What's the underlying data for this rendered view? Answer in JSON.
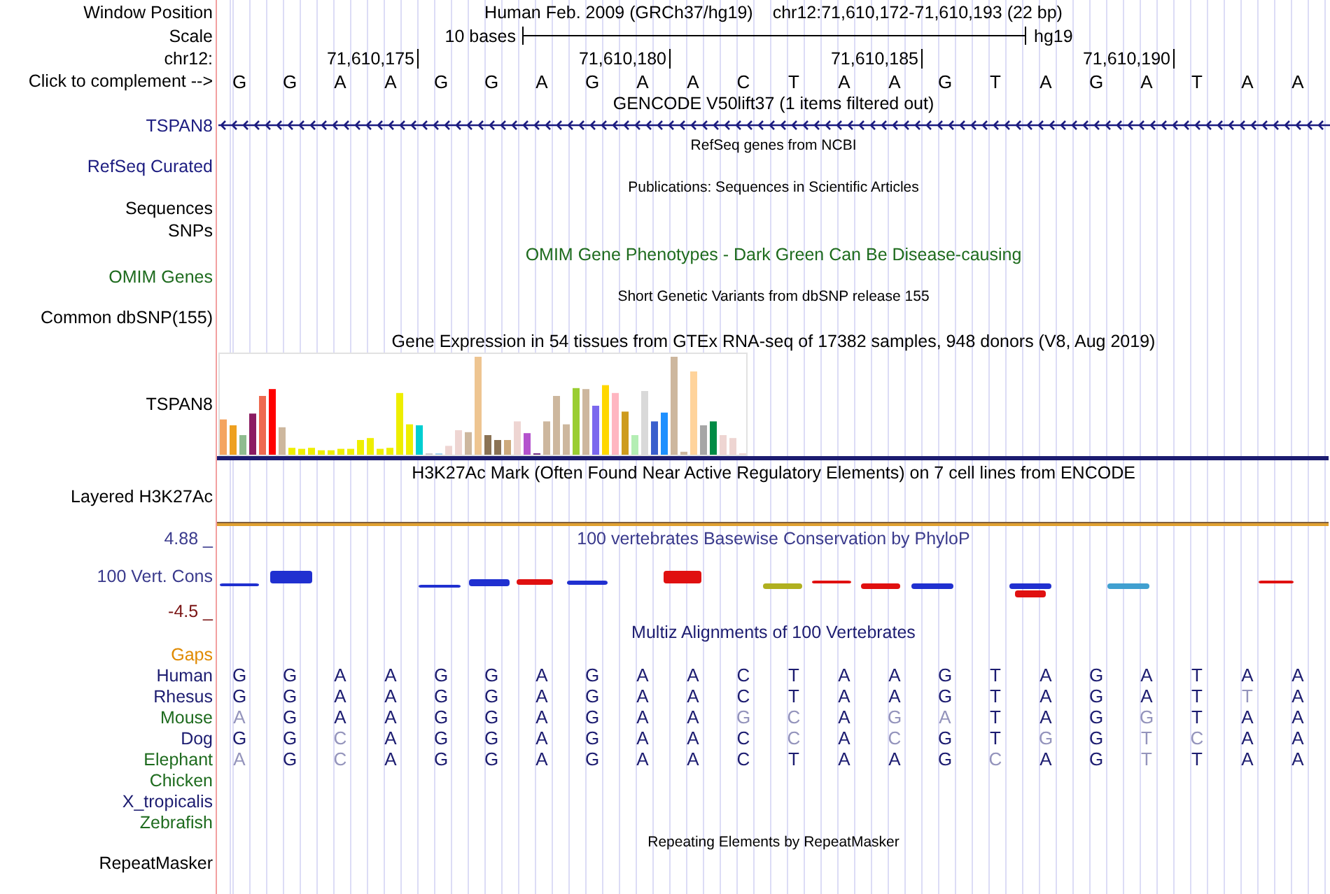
{
  "header": {
    "labels": [
      "Window Position",
      "Scale",
      "chr12:",
      "Click to complement -->"
    ],
    "assembly": "Human Feb. 2009 (GRCh37/hg19)",
    "range": "chr12:71,610,172-71,610,193 (22 bp)",
    "scale": "10 bases",
    "scale_db": "hg19",
    "ruler": [
      "71,610,175",
      "71,610,180",
      "71,610,185",
      "71,610,190"
    ],
    "sequence": [
      "G",
      "G",
      "A",
      "A",
      "G",
      "G",
      "A",
      "G",
      "A",
      "A",
      "C",
      "T",
      "A",
      "A",
      "G",
      "T",
      "A",
      "G",
      "A",
      "T",
      "A",
      "A"
    ]
  },
  "tracks": [
    {
      "kind": "gene",
      "title": {
        "text": "GENCODE V50lift37 (1 items filtered out)",
        "color": "#000000"
      },
      "labels": [
        {
          "text": "TSPAN8",
          "color": "#1c1c80"
        }
      ]
    },
    {
      "kind": "compact",
      "title": {
        "text": "RefSeq genes from NCBI",
        "color": "#000000"
      },
      "labels": [
        {
          "text": "RefSeq Curated",
          "color": "#1c1c80"
        }
      ]
    },
    {
      "kind": "compact",
      "title": {
        "text": "Publications: Sequences in Scientific Articles",
        "color": "#000000"
      },
      "labels": [
        {
          "text": "Sequences",
          "color": "#000000"
        },
        {
          "text": "SNPs",
          "color": "#000000"
        }
      ]
    },
    {
      "kind": "full",
      "title": {
        "text": "OMIM Gene Phenotypes - Dark Green Can Be Disease-causing",
        "color": "#1e6b1e"
      },
      "labels": [
        {
          "text": "OMIM Genes",
          "color": "#1e6b1e"
        }
      ]
    },
    {
      "kind": "compact",
      "title": {
        "text": "Short Genetic Variants from dbSNP release 155",
        "color": "#000000"
      },
      "labels": [
        {
          "text": "Common dbSNP(155)",
          "color": "#000000"
        }
      ]
    },
    {
      "kind": "bars",
      "title": {
        "text": "Gene Expression in 54 tissues from GTEx RNA-seq of 17382 samples, 948 donors (V8, Aug 2019)",
        "color": "#000000"
      },
      "labels": [
        {
          "text": "TSPAN8",
          "color": "#000000"
        }
      ]
    },
    {
      "kind": "signal",
      "title": {
        "text": "H3K27Ac Mark (Often Found Near Active Regulatory Elements) on 7 cell lines from ENCODE",
        "color": "#000000"
      },
      "labels": [
        {
          "text": "Layered H3K27Ac",
          "color": "#000000"
        }
      ]
    },
    {
      "kind": "conservation",
      "title": {
        "text": "100 vertebrates Basewise Conservation by PhyloP",
        "color": "#3a3a8c"
      },
      "labels": [
        {
          "text": "4.88 _",
          "color": "#3a3a8c"
        },
        {
          "text": "100 Vert. Cons",
          "color": "#3a3a8c"
        },
        {
          "text": "-4.5 _",
          "color": "#7a1414"
        }
      ]
    },
    {
      "kind": "alignment",
      "title": {
        "text": "Multiz Alignments of 100 Vertebrates",
        "color": "#1c1c70"
      },
      "labels": [
        {
          "text": "Gaps",
          "color": "#e08a00"
        }
      ],
      "species": [
        {
          "name": "Human",
          "color": "#1c1c70",
          "bases": [
            {
              "base": "G",
              "match": true
            },
            {
              "base": "G",
              "match": true
            },
            {
              "base": "A",
              "match": true
            },
            {
              "base": "A",
              "match": true
            },
            {
              "base": "G",
              "match": true
            },
            {
              "base": "G",
              "match": true
            },
            {
              "base": "A",
              "match": true
            },
            {
              "base": "G",
              "match": true
            },
            {
              "base": "A",
              "match": true
            },
            {
              "base": "A",
              "match": true
            },
            {
              "base": "C",
              "match": true
            },
            {
              "base": "T",
              "match": true
            },
            {
              "base": "A",
              "match": true
            },
            {
              "base": "A",
              "match": true
            },
            {
              "base": "G",
              "match": true
            },
            {
              "base": "T",
              "match": true
            },
            {
              "base": "A",
              "match": true
            },
            {
              "base": "G",
              "match": true
            },
            {
              "base": "A",
              "match": true
            },
            {
              "base": "T",
              "match": true
            },
            {
              "base": "A",
              "match": true
            },
            {
              "base": "A",
              "match": true
            }
          ]
        },
        {
          "name": "Rhesus",
          "color": "#1c1c70",
          "bases": [
            {
              "base": "G",
              "match": true
            },
            {
              "base": "G",
              "match": true
            },
            {
              "base": "A",
              "match": true
            },
            {
              "base": "A",
              "match": true
            },
            {
              "base": "G",
              "match": true
            },
            {
              "base": "G",
              "match": true
            },
            {
              "base": "A",
              "match": true
            },
            {
              "base": "G",
              "match": true
            },
            {
              "base": "A",
              "match": true
            },
            {
              "base": "A",
              "match": true
            },
            {
              "base": "C",
              "match": true
            },
            {
              "base": "T",
              "match": true
            },
            {
              "base": "A",
              "match": true
            },
            {
              "base": "A",
              "match": true
            },
            {
              "base": "G",
              "match": true
            },
            {
              "base": "T",
              "match": true
            },
            {
              "base": "A",
              "match": true
            },
            {
              "base": "G",
              "match": true
            },
            {
              "base": "A",
              "match": true
            },
            {
              "base": "T",
              "match": true
            },
            {
              "base": "T",
              "match": false
            },
            {
              "base": "A",
              "match": true
            }
          ]
        },
        {
          "name": "Mouse",
          "color": "#1e6b1e",
          "bases": [
            {
              "base": "A",
              "match": false
            },
            {
              "base": "G",
              "match": true
            },
            {
              "base": "A",
              "match": true
            },
            {
              "base": "A",
              "match": true
            },
            {
              "base": "G",
              "match": true
            },
            {
              "base": "G",
              "match": true
            },
            {
              "base": "A",
              "match": true
            },
            {
              "base": "G",
              "match": true
            },
            {
              "base": "A",
              "match": true
            },
            {
              "base": "A",
              "match": true
            },
            {
              "base": "G",
              "match": false
            },
            {
              "base": "C",
              "match": false
            },
            {
              "base": "A",
              "match": true
            },
            {
              "base": "G",
              "match": false
            },
            {
              "base": "A",
              "match": false
            },
            {
              "base": "T",
              "match": true
            },
            {
              "base": "A",
              "match": true
            },
            {
              "base": "G",
              "match": true
            },
            {
              "base": "G",
              "match": false
            },
            {
              "base": "T",
              "match": true
            },
            {
              "base": "A",
              "match": true
            },
            {
              "base": "A",
              "match": true
            }
          ]
        },
        {
          "name": "Dog",
          "color": "#1c1c70",
          "bases": [
            {
              "base": "G",
              "match": true
            },
            {
              "base": "G",
              "match": true
            },
            {
              "base": "C",
              "match": false
            },
            {
              "base": "A",
              "match": true
            },
            {
              "base": "G",
              "match": true
            },
            {
              "base": "G",
              "match": true
            },
            {
              "base": "A",
              "match": true
            },
            {
              "base": "G",
              "match": true
            },
            {
              "base": "A",
              "match": true
            },
            {
              "base": "A",
              "match": true
            },
            {
              "base": "C",
              "match": true
            },
            {
              "base": "C",
              "match": false
            },
            {
              "base": "A",
              "match": true
            },
            {
              "base": "C",
              "match": false
            },
            {
              "base": "G",
              "match": true
            },
            {
              "base": "T",
              "match": true
            },
            {
              "base": "G",
              "match": false
            },
            {
              "base": "G",
              "match": true
            },
            {
              "base": "T",
              "match": false
            },
            {
              "base": "C",
              "match": false
            },
            {
              "base": "A",
              "match": true
            },
            {
              "base": "A",
              "match": true
            }
          ]
        },
        {
          "name": "Elephant",
          "color": "#1e6b1e",
          "bases": [
            {
              "base": "A",
              "match": false
            },
            {
              "base": "G",
              "match": true
            },
            {
              "base": "C",
              "match": false
            },
            {
              "base": "A",
              "match": true
            },
            {
              "base": "G",
              "match": true
            },
            {
              "base": "G",
              "match": true
            },
            {
              "base": "A",
              "match": true
            },
            {
              "base": "G",
              "match": true
            },
            {
              "base": "A",
              "match": true
            },
            {
              "base": "A",
              "match": true
            },
            {
              "base": "C",
              "match": true
            },
            {
              "base": "T",
              "match": true
            },
            {
              "base": "A",
              "match": true
            },
            {
              "base": "A",
              "match": true
            },
            {
              "base": "G",
              "match": true
            },
            {
              "base": "C",
              "match": false
            },
            {
              "base": "A",
              "match": true
            },
            {
              "base": "G",
              "match": true
            },
            {
              "base": "T",
              "match": false
            },
            {
              "base": "T",
              "match": true
            },
            {
              "base": "A",
              "match": true
            },
            {
              "base": "A",
              "match": true
            }
          ]
        },
        {
          "name": "Chicken",
          "color": "#1e6b1e"
        },
        {
          "name": "X_tropicalis",
          "color": "#1c1c70"
        },
        {
          "name": "Zebrafish",
          "color": "#1e6b1e"
        }
      ]
    },
    {
      "kind": "compact",
      "title": {
        "text": "Repeating Elements by RepeatMasker",
        "color": "#000000"
      },
      "labels": [
        {
          "text": "RepeatMasker",
          "color": "#000000"
        }
      ]
    }
  ]
}
